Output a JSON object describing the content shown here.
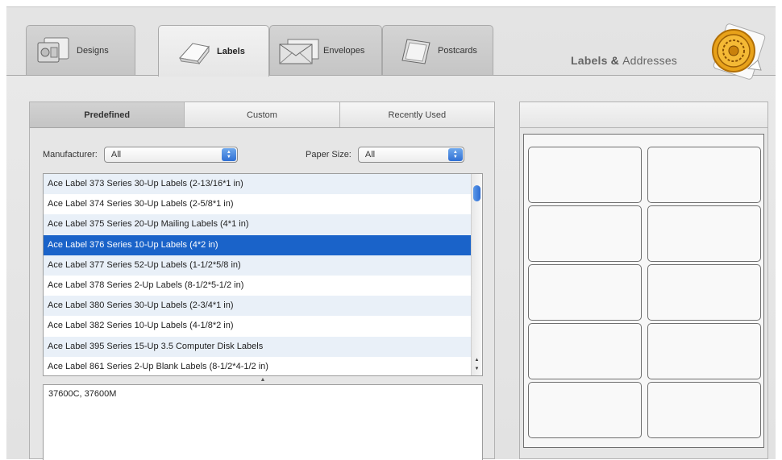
{
  "tabs": [
    {
      "label": "Designs",
      "icon": "designs-icon"
    },
    {
      "label": "Labels",
      "icon": "labels-icon",
      "active": true
    },
    {
      "label": "Envelopes",
      "icon": "envelopes-icon"
    },
    {
      "label": "Postcards",
      "icon": "postcards-icon"
    }
  ],
  "app_title": {
    "part1": "Labels",
    "amp": "&",
    "part2": "Addresses"
  },
  "segments": [
    {
      "label": "Predefined",
      "active": true
    },
    {
      "label": "Custom"
    },
    {
      "label": "Recently Used"
    }
  ],
  "filters": {
    "manufacturer_label": "Manufacturer:",
    "manufacturer_value": "All",
    "paper_size_label": "Paper Size:",
    "paper_size_value": "All"
  },
  "label_list": [
    "Ace Label 373 Series 30-Up Labels (2-13/16*1 in)",
    "Ace Label 374 Series 30-Up Labels (2-5/8*1 in)",
    "Ace Label 375 Series 20-Up Mailing Labels (4*1 in)",
    "Ace Label 376 Series 10-Up Labels (4*2 in)",
    "Ace Label 377 Series 52-Up Labels (1-1/2*5/8 in)",
    "Ace Label 378 Series 2-Up Labels (8-1/2*5-1/2 in)",
    "Ace Label 380 Series 30-Up Labels (2-3/4*1 in)",
    "Ace Label 382 Series 10-Up Labels (4-1/8*2 in)",
    "Ace Label 395 Series 15-Up 3.5 Computer Disk Labels",
    "Ace Label 861 Series 2-Up Blank Labels (8-1/2*4-1/2 in)"
  ],
  "selected_index": 3,
  "notes_text": "37600C, 37600M",
  "preview": {
    "rows": 5,
    "cols": 2
  },
  "colors": {
    "selection": "#1a63c9",
    "accent": "#2f6fd4"
  }
}
